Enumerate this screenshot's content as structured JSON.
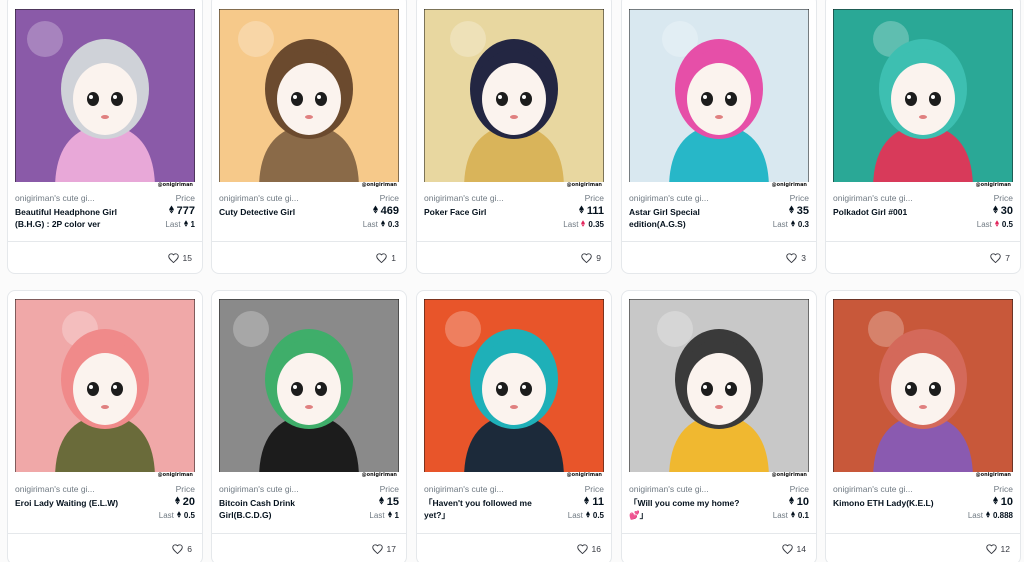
{
  "labels": {
    "price": "Price",
    "last": "Last",
    "artist_tag": "@onigiriman"
  },
  "colors": {
    "eth": "#04111d",
    "eth_pink": "#e2265d",
    "muted": "#707a83"
  },
  "cards": [
    {
      "collection": "onigiriman's cute gi...",
      "title": "Beautiful Headphone Girl (B.H.G) : 2P color ver",
      "price": "777",
      "last": "1",
      "last_icon": "eth-icon",
      "likes": "15"
    },
    {
      "collection": "onigiriman's cute gi...",
      "title": "Cuty Detective Girl",
      "price": "469",
      "last": "0.3",
      "last_icon": "eth-icon",
      "likes": "1"
    },
    {
      "collection": "onigiriman's cute gi...",
      "title": "Poker Face Girl",
      "price": "111",
      "last": "0.35",
      "last_icon": "eth-pink-icon",
      "likes": "9"
    },
    {
      "collection": "onigiriman's cute gi...",
      "title": "Astar Girl Special edition(A.G.S)",
      "price": "35",
      "last": "0.3",
      "last_icon": "eth-icon",
      "likes": "3"
    },
    {
      "collection": "onigiriman's cute gi...",
      "title": "Polkadot Girl #001",
      "price": "30",
      "last": "0.5",
      "last_icon": "eth-pink-icon",
      "likes": "7"
    },
    {
      "collection": "onigiriman's cute gi...",
      "title": "Eroi Lady Waiting (E.L.W)",
      "price": "20",
      "last": "0.5",
      "last_icon": "eth-icon",
      "likes": "6"
    },
    {
      "collection": "onigiriman's cute gi...",
      "title": "Bitcoin Cash Drink Girl(B.C.D.G)",
      "price": "15",
      "last": "1",
      "last_icon": "eth-icon",
      "likes": "17"
    },
    {
      "collection": "onigiriman's cute gi...",
      "title": "「Haven't you followed me yet?」",
      "price": "11",
      "last": "0.5",
      "last_icon": "eth-icon",
      "likes": "16"
    },
    {
      "collection": "onigiriman's cute gi...",
      "title": "「Will you come my home?💕」",
      "price": "10",
      "last": "0.1",
      "last_icon": "eth-icon",
      "likes": "14"
    },
    {
      "collection": "onigiriman's cute gi...",
      "title": "Kimono ETH Lady(K.E.L)",
      "price": "10",
      "last": "0.888",
      "last_icon": "eth-icon",
      "likes": "12"
    }
  ],
  "artworks": [
    {
      "name": "headphone-girl",
      "bg": "#8a5aa8",
      "hair": "#cfd2d8",
      "accent": "#e8a8d8"
    },
    {
      "name": "detective-girl",
      "bg": "#f6c98a",
      "hair": "#6b4a2e",
      "accent": "#8a6a48"
    },
    {
      "name": "poker-face-girl",
      "bg": "#e8d7a0",
      "hair": "#232642",
      "accent": "#d9b45a"
    },
    {
      "name": "astar-girl",
      "bg": "#d9e8f0",
      "hair": "#e64fa8",
      "accent": "#27b7c8"
    },
    {
      "name": "polkadot-girl",
      "bg": "#2aa896",
      "hair": "#3dbfb1",
      "accent": "#d83a5a"
    },
    {
      "name": "eroi-lady",
      "bg": "#f0a8a8",
      "hair": "#f08a8a",
      "accent": "#6a6b3a"
    },
    {
      "name": "bitcoin-drink-girl",
      "bg": "#8a8a8a",
      "hair": "#3fae6a",
      "accent": "#1c1c1c"
    },
    {
      "name": "follow-girl",
      "bg": "#e8552a",
      "hair": "#1eb0b8",
      "accent": "#1c2a3a"
    },
    {
      "name": "beer-girl",
      "bg": "#c8c8c8",
      "hair": "#3a3a3a",
      "accent": "#f0b830"
    },
    {
      "name": "kimono-eth-lady",
      "bg": "#c8583a",
      "hair": "#d4695a",
      "accent": "#8a5ab0"
    }
  ]
}
